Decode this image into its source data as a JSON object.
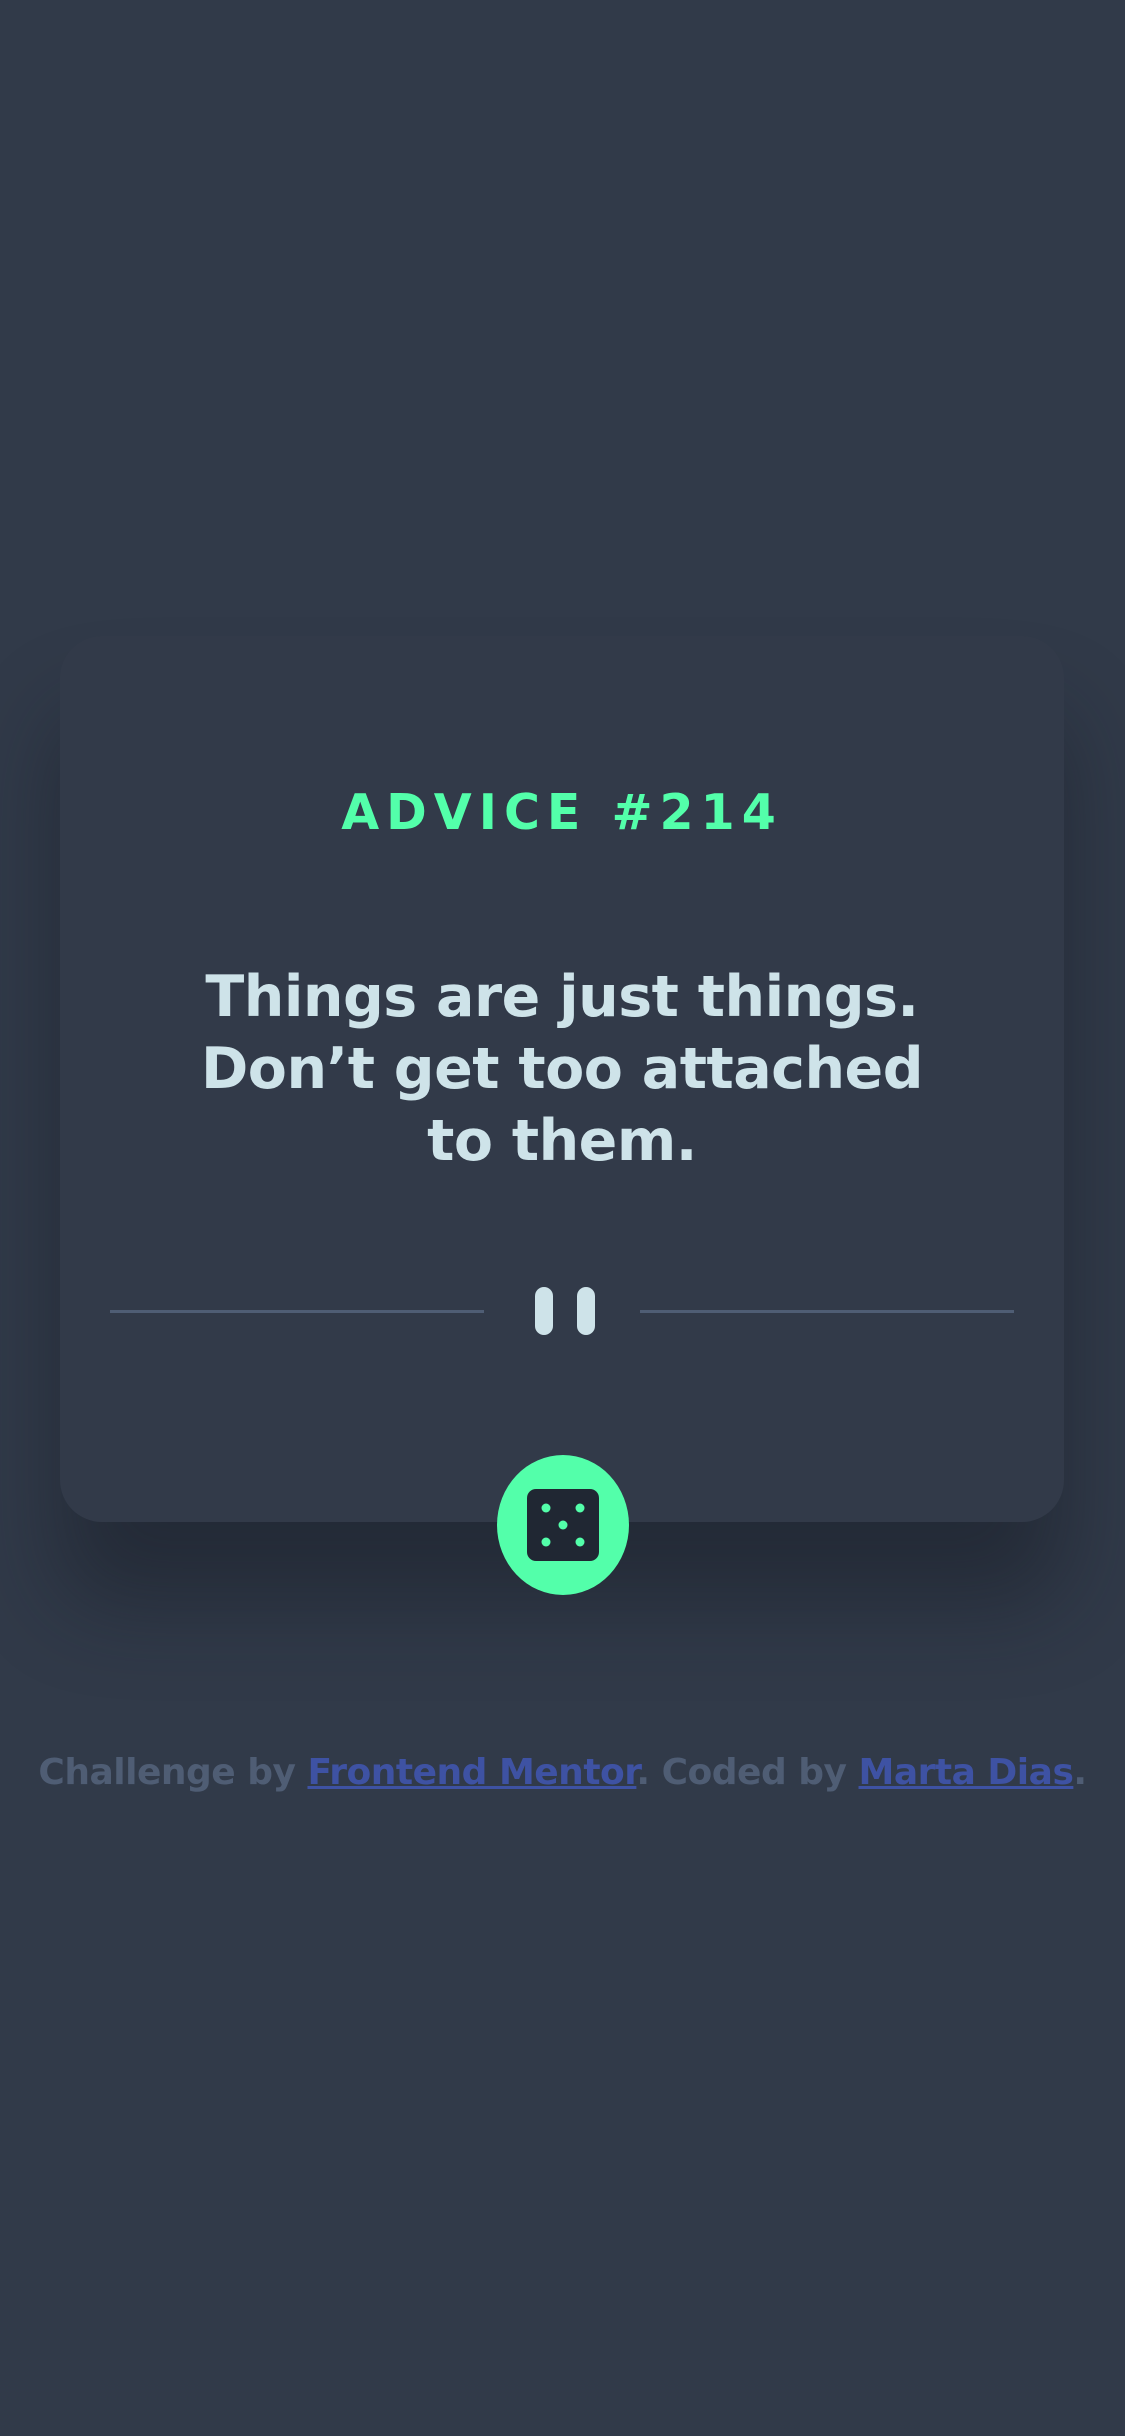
{
  "card": {
    "advice_label": "ADVICE #214",
    "quote": "Things are just things. Don’t get too attached to them."
  },
  "icons": {
    "pause": "pause-icon",
    "dice": "dice-icon"
  },
  "footer": {
    "prefix": "Challenge by ",
    "link1": "Frontend Mentor",
    "middle": ". Coded by ",
    "link2": "Marta Dias",
    "suffix": "."
  },
  "colors": {
    "background": "#313a49",
    "card": "#323a49",
    "accent": "#53ffaa",
    "text": "#cee3e9",
    "muted": "#4f5d74",
    "link": "#3e52a3"
  }
}
